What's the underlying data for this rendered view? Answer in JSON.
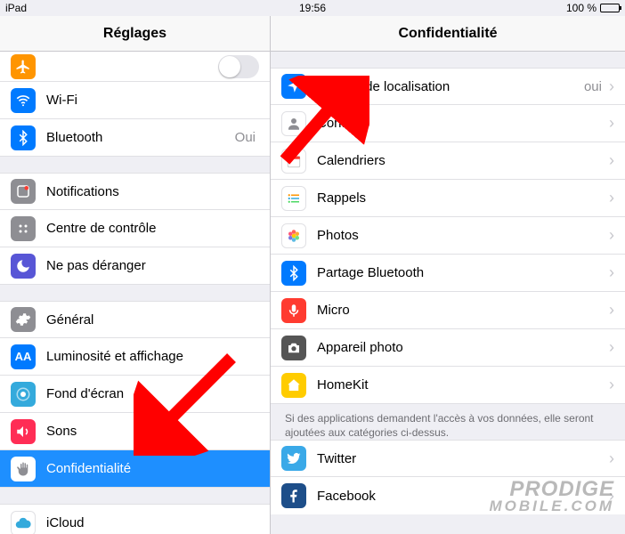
{
  "statusbar": {
    "device": "iPad",
    "time": "19:56",
    "battery": "100 %"
  },
  "sidebar": {
    "title": "Réglages",
    "groups": [
      {
        "items": [
          {
            "icon": "airplane",
            "label": "",
            "toggle": true
          },
          {
            "icon": "wifi",
            "label": "Wi-Fi",
            "value": ""
          },
          {
            "icon": "bluetooth",
            "label": "Bluetooth",
            "value": "Oui"
          }
        ]
      },
      {
        "items": [
          {
            "icon": "notifications",
            "label": "Notifications"
          },
          {
            "icon": "controlcenter",
            "label": "Centre de contrôle"
          },
          {
            "icon": "dnd",
            "label": "Ne pas déranger"
          }
        ]
      },
      {
        "items": [
          {
            "icon": "general",
            "label": "Général"
          },
          {
            "icon": "display",
            "label": "Luminosité et affichage"
          },
          {
            "icon": "wallpaper",
            "label": "Fond d'écran"
          },
          {
            "icon": "sounds",
            "label": "Sons"
          },
          {
            "icon": "privacy",
            "label": "Confidentialité",
            "selected": true
          }
        ]
      },
      {
        "items": [
          {
            "icon": "icloud",
            "label": "iCloud"
          }
        ]
      }
    ]
  },
  "detail": {
    "title": "Confidentialité",
    "groups": [
      {
        "items": [
          {
            "icon": "location",
            "label": "Service de localisation",
            "value": "oui"
          },
          {
            "icon": "contacts",
            "label": "Contacts"
          },
          {
            "icon": "calendars",
            "label": "Calendriers"
          },
          {
            "icon": "reminders",
            "label": "Rappels"
          },
          {
            "icon": "photos",
            "label": "Photos"
          },
          {
            "icon": "btshare",
            "label": "Partage Bluetooth"
          },
          {
            "icon": "mic",
            "label": "Micro"
          },
          {
            "icon": "camera",
            "label": "Appareil photo"
          },
          {
            "icon": "homekit",
            "label": "HomeKit"
          }
        ],
        "footer": "Si des applications demandent l'accès à vos données, elle seront ajoutées aux catégories ci-dessus."
      },
      {
        "items": [
          {
            "icon": "twitter",
            "label": "Twitter"
          },
          {
            "icon": "facebook",
            "label": "Facebook"
          }
        ]
      }
    ]
  },
  "watermark": {
    "line1": "PRODIGE",
    "line2": "MOBILE.COM"
  }
}
